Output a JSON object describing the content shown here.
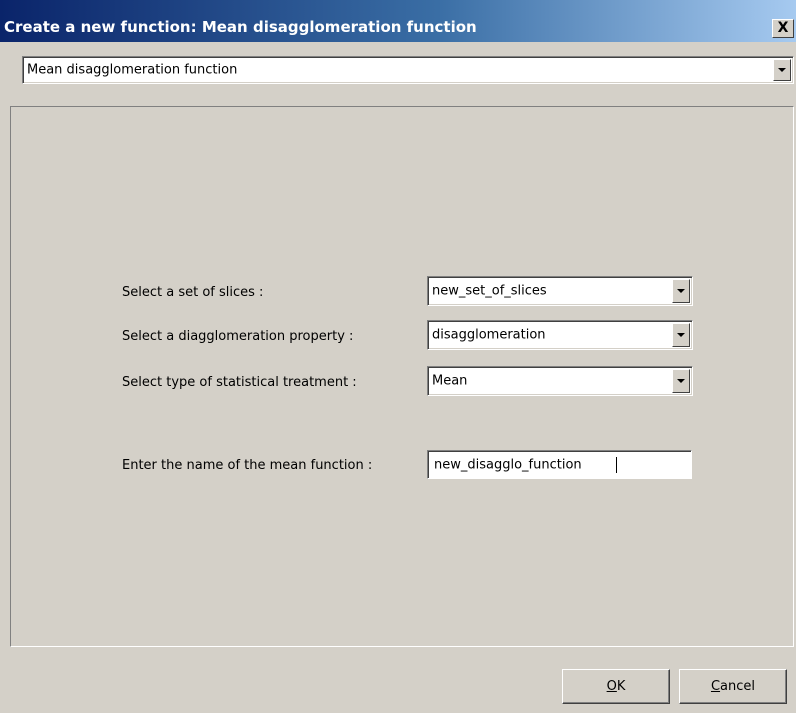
{
  "window": {
    "title": "Create a new function: Mean disagglomeration function",
    "close_label": "X"
  },
  "function_type": {
    "selected": "Mean disagglomeration function"
  },
  "form": {
    "slices_label": "Select a set of slices :",
    "slices_value": "new_set_of_slices",
    "property_label": "Select a diagglomeration property :",
    "property_value": "disagglomeration",
    "treatment_label": "Select type of statistical treatment :",
    "treatment_value": "Mean",
    "name_label": "Enter the name of the mean function :",
    "name_value": "new_disagglo_function"
  },
  "buttons": {
    "ok_mnemonic": "O",
    "ok_rest": "K",
    "cancel_mnemonic": "C",
    "cancel_rest": "ancel"
  },
  "icons": {
    "close": "close-icon",
    "dropdown": "chevron-down-icon"
  },
  "colors": {
    "title_start": "#0a246a",
    "title_end": "#a6caf0",
    "face": "#d4d0c8"
  }
}
